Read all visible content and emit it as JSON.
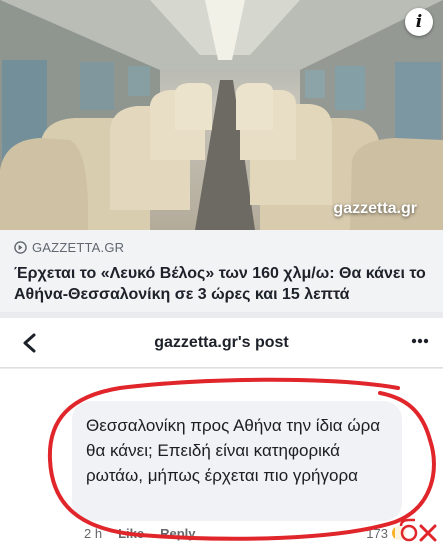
{
  "preview": {
    "watermark": "gazzetta.gr",
    "info_icon": "i",
    "source": "GAZZETTA.GR",
    "headline": "Έρχεται το «Λευκό Βέλος» των 160 χλμ/ω: Θα κάνει το Αθήνα-Θεσσαλονίκη σε 3 ώρες και 15 λεπτά"
  },
  "post_header": {
    "title": "gazzetta.gr's post",
    "back_icon": "chevron-left-icon",
    "more_icon": "more-dots-icon"
  },
  "comment": {
    "text": "Θεσσαλονίκη προς Αθήνα την ίδια ώρα θα κάνει; Επειδή είναι κατηφορικά ρωτάω, μήπως έρχεται πιο γρήγορα",
    "time": "2 h",
    "like_label": "Like",
    "reply_label": "Reply",
    "reaction_count": "173"
  },
  "colors": {
    "highlight_circle": "#e0262b",
    "reaction": "#f7b125",
    "meta_bg": "#f2f3f5",
    "bubble_bg": "#f0f2f5"
  }
}
